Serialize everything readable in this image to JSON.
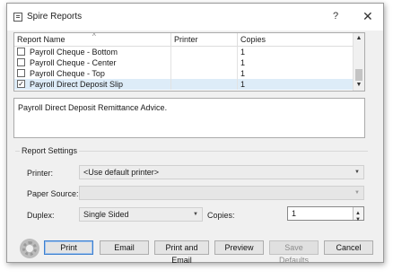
{
  "window": {
    "title": "Spire Reports",
    "help": "?",
    "close": "✕"
  },
  "grid": {
    "columns": [
      "Report Name",
      "Printer",
      "Copies"
    ],
    "sort_caret": "^",
    "rows": [
      {
        "name": "Payroll Cheque - Bottom",
        "printer": "",
        "copies": "1",
        "checked": false
      },
      {
        "name": "Payroll Cheque - Center",
        "printer": "",
        "copies": "1",
        "checked": false
      },
      {
        "name": "Payroll Cheque - Top",
        "printer": "",
        "copies": "1",
        "checked": false
      },
      {
        "name": "Payroll Direct Deposit Slip",
        "printer": "",
        "copies": "1",
        "checked": true
      }
    ],
    "scroll_up": "▲",
    "scroll_down": "▼"
  },
  "description": "Payroll Direct Deposit Remittance Advice.",
  "settings": {
    "legend": "Report Settings",
    "printer_label": "Printer:",
    "printer_value": "<Use default printer>",
    "paper_source_label": "Paper Source:",
    "paper_source_value": "",
    "duplex_label": "Duplex:",
    "duplex_value": "Single Sided",
    "copies_label": "Copies:",
    "copies_value": "1",
    "dropdown_arrow": "▼"
  },
  "buttons": {
    "print": "Print",
    "email": "Email",
    "print_and_email": "Print and Email",
    "preview": "Preview",
    "save_defaults": "Save Defaults",
    "cancel": "Cancel"
  },
  "icons": [
    "report-window-icon",
    "help-icon",
    "close-icon",
    "checkbox-icon",
    "gear-icon",
    "dropdown-arrow-icon"
  ],
  "colors": {
    "selected_row": "#ddecf8",
    "default_button_border": "#3c7fd0"
  }
}
